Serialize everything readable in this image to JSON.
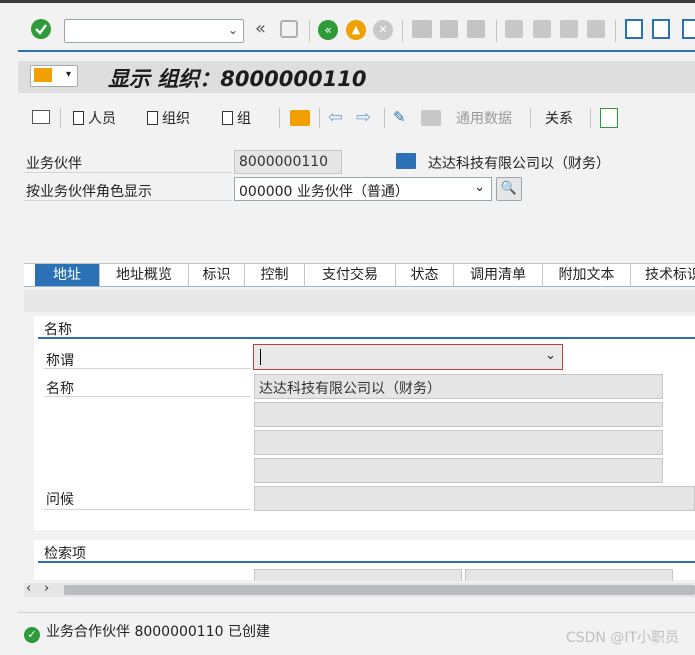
{
  "toolbar": {
    "command_field": "",
    "icons": [
      "check-icon",
      "back-double-icon",
      "save-icon",
      "back-green-icon",
      "exit-icon",
      "cancel-icon",
      "print-icon",
      "find-icon",
      "find-next-icon",
      "first-page-icon",
      "prev-page-icon",
      "next-page-icon",
      "last-page-icon",
      "new-session-icon",
      "shortcut-icon",
      "help-icon"
    ]
  },
  "title": {
    "label": "显示 组织：8000000110"
  },
  "actions": {
    "person": "人员",
    "org": "组织",
    "group": "组",
    "general_data": "通用数据",
    "relations": "关系"
  },
  "header_fields": {
    "bp_label": "业务伙伴",
    "bp_value": "8000000110",
    "bp_name": "达达科技有限公司以（财务）",
    "role_label": "按业务伙伴角色显示",
    "role_value": "000000 业务伙伴（普通）"
  },
  "tabs": [
    "地址",
    "地址概览",
    "标识",
    "控制",
    "支付交易",
    "状态",
    "调用清单",
    "附加文本",
    "技术标识"
  ],
  "active_tab": 0,
  "name_group": {
    "title": "名称",
    "salutation_label": "称谓",
    "salutation_value": "",
    "name_label": "名称",
    "name_value": "达达科技有限公司以（财务）",
    "greeting_label": "问候"
  },
  "search_group": {
    "title": "检索项"
  },
  "status_bar": {
    "message": "业务合作伙伴 8000000110 已创建"
  },
  "watermark": "CSDN @IT小职员",
  "colors": {
    "accent": "#2a72b5",
    "success": "#2e9a3a"
  }
}
